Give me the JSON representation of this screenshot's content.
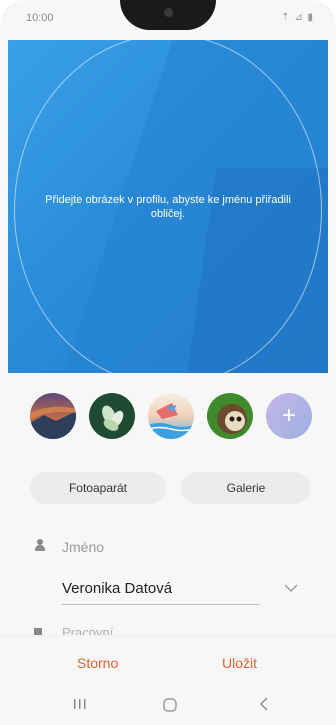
{
  "status_bar": {
    "time": "10:00",
    "icons": "⇡ ⊿ ▮"
  },
  "hero": {
    "hint": "Přidejte obrázek v profilu, abyste ke jménu přiřadili obličej."
  },
  "avatars": [
    {
      "icon": "sunset-landscape-avatar"
    },
    {
      "icon": "plant-avatar"
    },
    {
      "icon": "beach-illustration-avatar"
    },
    {
      "icon": "sloth-avatar"
    },
    {
      "icon": "add-avatar-icon",
      "label": "+"
    }
  ],
  "buttons": {
    "camera": "Fotoaparát",
    "gallery": "Galerie"
  },
  "name_field": {
    "label": "Jméno",
    "value": "Veronika Datová"
  },
  "next_field": {
    "label": "Pracovní"
  },
  "actions": {
    "cancel": "Storno",
    "save": "Uložit"
  },
  "colors": {
    "accent": "#e0632c",
    "hero_blue": "#2a8ddb"
  }
}
